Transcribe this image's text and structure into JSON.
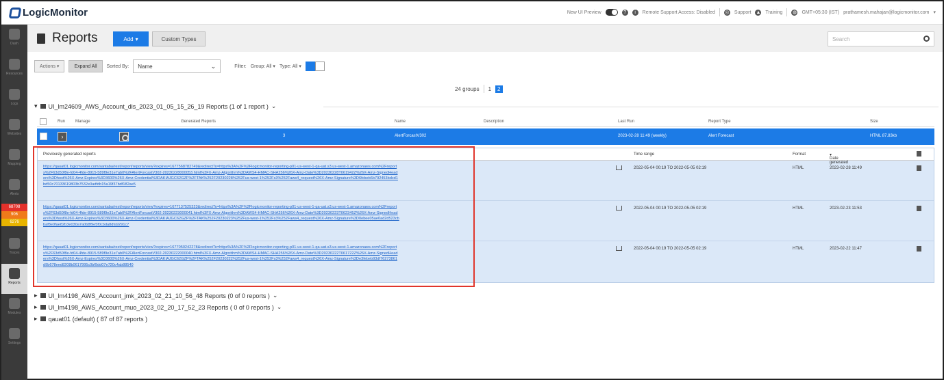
{
  "topbar": {
    "brand": "LogicMonitor",
    "new_ui_preview": "New UI Preview",
    "remote_support": "Remote Support Access: Disabled",
    "support": "Support",
    "training": "Training",
    "timezone": "GMT+05:30 (IST)",
    "user": "prathamesh.mahajan@logicmonitor.com"
  },
  "sidebar": {
    "items": [
      {
        "label": "Dash"
      },
      {
        "label": "Resources"
      },
      {
        "label": "Logs"
      },
      {
        "label": "Websites"
      },
      {
        "label": "Mapping"
      },
      {
        "label": "Alerts"
      },
      {
        "label": "Traces"
      },
      {
        "label": "Reports"
      },
      {
        "label": "Modules"
      },
      {
        "label": "Settings"
      }
    ],
    "alert_counts": [
      "68708",
      "906",
      "6276"
    ]
  },
  "header": {
    "title": "Reports",
    "add_label": "Add",
    "custom_types_label": "Custom Types",
    "search_placeholder": "Search"
  },
  "toolbar": {
    "actions_label": "Actions",
    "expand_all_label": "Expand All",
    "sorted_by_label": "Sorted By:",
    "sort_value": "Name",
    "filter_label": "Filter:",
    "group_filter": "Group: All",
    "type_filter": "Type: All"
  },
  "pager": {
    "groups_text": "24 groups",
    "pages": [
      "1",
      "2"
    ]
  },
  "groups": [
    {
      "name": "UI_lm24609_AWS_Account_dis_2023_01_05_15_26_19 Reports (1 of 1 report )"
    },
    {
      "name": "UI_lm4198_AWS_Account_jmk_2023_02_21_10_56_48 Reports (0 of 0 reports )"
    },
    {
      "name": "UI_lm4198_AWS_Account_muo_2023_02_20_17_52_23 Reports ( 0 of 0 reports )"
    },
    {
      "name": "qauat01 (default) ( 87 of 87 reports )"
    }
  ],
  "table": {
    "headers": {
      "run": "Run",
      "manage": "Manage",
      "generated_reports": "Generated Reports",
      "name": "Name",
      "description": "Description",
      "last_run": "Last Run",
      "report_type": "Report Type",
      "size": "Size"
    },
    "row": {
      "generated_reports": "3",
      "name": "AlertForcastV302",
      "description": "",
      "last_run": "2023-02-28 11:49 (weekly)",
      "report_type": "Alert Forecast",
      "size": "HTML 87.83kb"
    }
  },
  "history": {
    "title": "Previously generated reports",
    "headers": {
      "time_range": "Time range",
      "format": "Format",
      "date_generated": "Date generated"
    },
    "rows": [
      {
        "url": "https://qauat01.logicmonitor.com/santaba/rest/report/reports/view?expires=1677568782749&redirectTo=https%3A%2F%2Flogicmonitor-reporting-p01-us-west-1-qa-uat.s3.us-west-1.amazonaws.com%2Freports%2F63d50f8e-fd04-4fde-8915-589f9e31e7ab0%2FAlertForcastV302-20230228000053.html%3FX-Amz-Algorithm%3DAWS4-HMAC-SHA256%26X-Amz-Date%3D20230228T061942Z%26X-Amz-SignedHeaders%3Dhost%26X-Amz-Expires%3D3600%26X-Amz-Credential%3DAKIAJGC62GZF%2FTAK%252F20230228%252Fus-west-1%252Fs3%252Faws4_request%26X-Amz-Signature%3D6fcbeb6b792453bdcd1bd50c70133619803b7532e0adfdb15a19f37bdf182ae5",
        "time_range": "2022-05-04 00:19 TO 2022-05-05 02:19",
        "format": "HTML",
        "date_generated": "2023-02-28 11:49"
      },
      {
        "url": "https://qauat01.logicmonitor.com/santaba/rest/report/reports/view?expires=1677137525323&redirectTo=https%3A%2F%2Flogicmonitor-reporting-p01-us-west-1-qa-uat.s3.us-west-1.amazonaws.com%2Freports%2F63d50f8e-fd04-4fde-8915-589f9e31e7ab0%2FAlertForcastV302-20230223000041.html%3FX-Amz-Algorithm%3DAWS4-HMAC-SHA256%26X-Amz-Date%3D20230223T062345Z%26X-Amz-SignedHeaders%3Dhost%26X-Amz-Expires%3D3600%26X-Amz-Credential%3DAKIAJGC62GZF%2FTAK%252F20230223%252Fus-west-1%252Fs3%252Faws4_request%26X-Amz-Signature%3D0ebee05ae0ad2d523cbbaf8e0fae82b3e030a7a0b8f9e5f0cbda8dfa9291c7",
        "time_range": "2022-05-04 00:19 TO 2022-05-05 02:19",
        "format": "HTML",
        "date_generated": "2023-02-23 11:53"
      },
      {
        "url": "https://qauat01.logicmonitor.com/santaba/rest/report/reports/view?expires=1677050242278&redirectTo=https%3A%2F%2Flogicmonitor-reporting-p01-us-west-1-qa-uat.s3.us-west-1.amazonaws.com%2Freports%2F63d50f8e-fd04-4fde-8915-589f9e31e7ab0%2FAlertForcastV302-20230222000040.html%3FX-Amz-Algorithm%3DAWS4-HMAC-SHA256%26X-Amz-Date%3D20230222T061722Z%26X-Amz-SignedHeaders%3Dhost%26X-Amz-Expires%3D3600%26X-Amz-Credential%3DAKIAJGC62GZF%2FTAK%252F20230222%252Fus-west-1%252Fs3%252Faws4_request%26X-Amz-Signature%3De3febeb93df76273861d9b678eed8208b0617995c0bf9dd07e720c4ab88540",
        "time_range": "2022-05-04 00:19 TO 2022-05-05 02:19",
        "format": "HTML",
        "date_generated": "2023-02-22 11:47"
      }
    ]
  },
  "colors": {
    "accent": "#1c7be6",
    "sidebar": "#3a3a3a",
    "highlight_box": "#e0352b",
    "alert_critical": "#e4312b",
    "alert_error": "#f07a1a",
    "alert_warning": "#e8b400"
  }
}
